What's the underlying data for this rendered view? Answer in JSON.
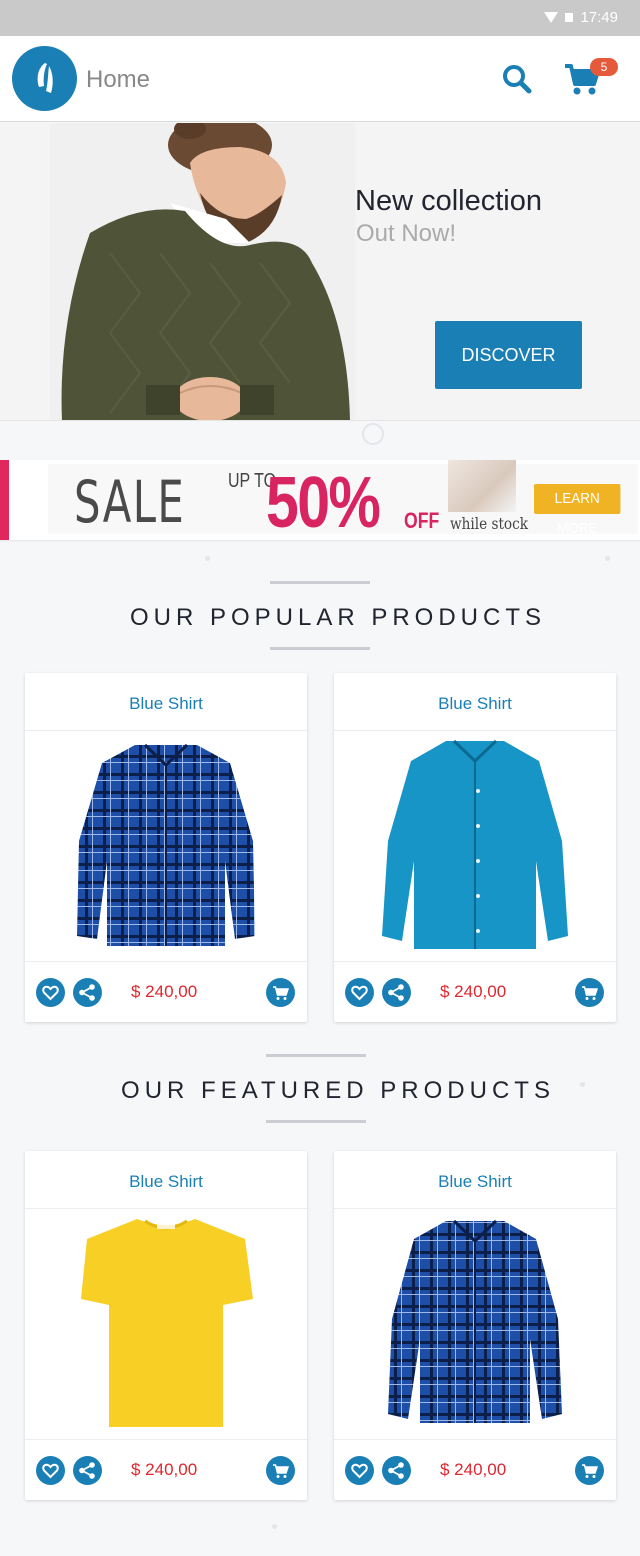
{
  "status_bar": {
    "time": "17:49"
  },
  "header": {
    "title": "Home",
    "cart_count": "5"
  },
  "hero": {
    "title": "New collection",
    "subtitle": "Out Now!",
    "button_label": "DISCOVER"
  },
  "sale_banner": {
    "sale": "SALE",
    "up_to": "UP TO",
    "percent": "50%",
    "off": "OFF",
    "note": "while stock",
    "button_label": "LEARN MORE"
  },
  "sections": [
    {
      "title": "OUR POPULAR PRODUCTS",
      "products": [
        {
          "name": "Blue Shirt",
          "price": "$ 240,00",
          "image": "plaid-shirt"
        },
        {
          "name": "Blue Shirt",
          "price": "$ 240,00",
          "image": "teal-shirt"
        }
      ]
    },
    {
      "title": "OUR FEATURED PRODUCTS",
      "products": [
        {
          "name": "Blue Shirt",
          "price": "$ 240,00",
          "image": "yellow-tshirt"
        },
        {
          "name": "Blue Shirt",
          "price": "$ 240,00",
          "image": "plaid-shirt"
        }
      ]
    }
  ],
  "colors": {
    "primary": "#1a7fb5",
    "price": "#e0262e",
    "badge": "#e55a3a",
    "sale_pink": "#d82461",
    "learn_more": "#f0b323"
  },
  "icons": [
    "logo-icon",
    "search-icon",
    "cart-icon",
    "heart-icon",
    "share-icon",
    "add-to-cart-icon"
  ]
}
